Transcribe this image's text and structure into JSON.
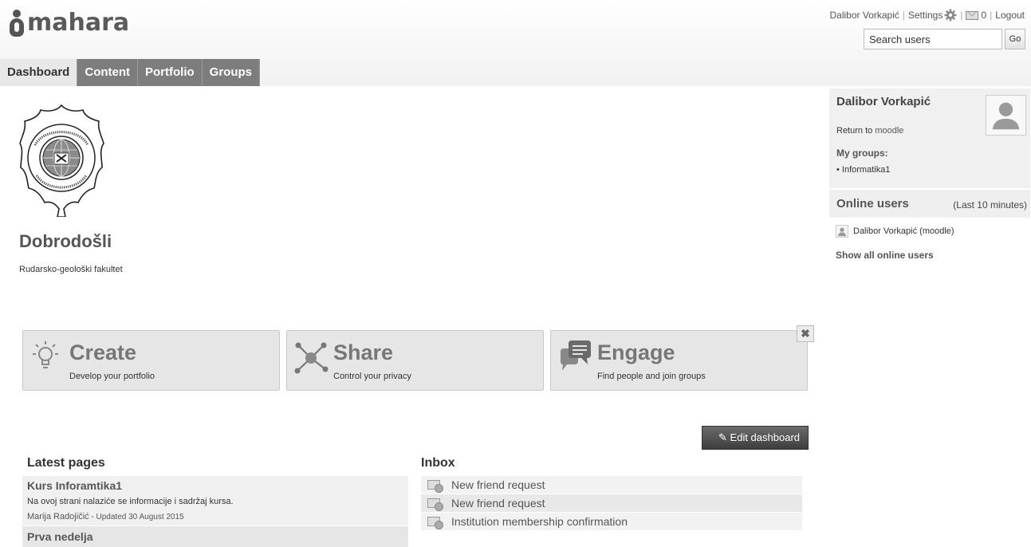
{
  "header": {
    "logo_text": "mahara",
    "user_name": "Dalibor Vorkapić",
    "settings_label": "Settings",
    "mail_count": "0",
    "logout_label": "Logout",
    "search_placeholder": "Search users",
    "search_value": "Search users",
    "go_label": "Go"
  },
  "nav": {
    "tabs": [
      {
        "label": "Dashboard",
        "active": true
      },
      {
        "label": "Content"
      },
      {
        "label": "Portfolio"
      },
      {
        "label": "Groups"
      }
    ]
  },
  "main": {
    "welcome_title": "Dobrodošli",
    "welcome_sub": "Rudarsko-geološki fakultet",
    "quick_links": [
      {
        "title": "Create",
        "subtitle": "Develop your portfolio",
        "icon": "lightbulb-icon"
      },
      {
        "title": "Share",
        "subtitle": "Control your privacy",
        "icon": "share-network-icon"
      },
      {
        "title": "Engage",
        "subtitle": "Find people and join groups",
        "icon": "speech-bubbles-icon"
      }
    ],
    "close_glyph": "✖",
    "edit_dashboard_label": "Edit dashboard",
    "latest_pages": {
      "title": "Latest pages",
      "items": [
        {
          "title": "Kurs Inforamtika1",
          "description": "Na ovoj strani nalaziće se informacije i sadržaj kursa.",
          "author": "Marija Radojičić",
          "updated": " - Updated 30 August 2015"
        },
        {
          "title": "Prva nedelja"
        }
      ]
    },
    "inbox": {
      "title": "Inbox",
      "items": [
        "New friend request",
        "New friend request",
        "Institution membership confirmation"
      ]
    }
  },
  "sidebar": {
    "user_name": "Dalibor Vorkapić",
    "return_prefix": "Return to ",
    "return_link": "moodle",
    "my_groups_label": "My groups:",
    "groups": [
      "Informatika1"
    ],
    "online_title": "Online users",
    "online_period": "(Last 10 minutes)",
    "online_users": [
      "Dalibor Vorkapić (moodle)"
    ],
    "show_all_label": "Show all online users"
  }
}
